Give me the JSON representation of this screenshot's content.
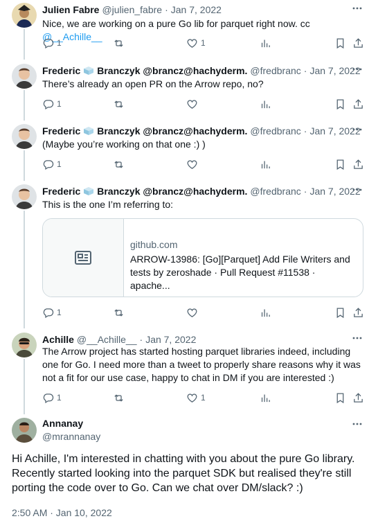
{
  "tweets": [
    {
      "name": "Julien Fabre",
      "handle": "@julien_fabre",
      "date": "Jan 7, 2022",
      "text_prefix": "Nice, we are working on a pure Go lib for parquet right now. cc ",
      "mention": "@__Achille__",
      "replies": "1",
      "retweets": "",
      "likes": "1"
    },
    {
      "name": "Frederic",
      "name_suffix": "Branczyk @brancz@hachyderm.",
      "handle": "@fredbranc",
      "date": "Jan 7, 2022",
      "text": "There’s already an open PR on the Arrow repo, no?",
      "replies": "1",
      "retweets": "",
      "likes": ""
    },
    {
      "name": "Frederic",
      "name_suffix": "Branczyk @brancz@hachyderm.",
      "handle": "@fredbranc",
      "date": "Jan 7, 2022",
      "text": "(Maybe you’re working on that one :) )",
      "replies": "1",
      "retweets": "",
      "likes": ""
    },
    {
      "name": "Frederic",
      "name_suffix": "Branczyk @brancz@hachyderm.",
      "handle": "@fredbranc",
      "date": "Jan 7, 2022",
      "text": "This is the one I’m referring to:",
      "card": {
        "domain": "github.com",
        "title": "ARROW-13986: [Go][Parquet] Add File Writers and tests by zeroshade · Pull Request #11538 · apache..."
      },
      "replies": "1",
      "retweets": "",
      "likes": ""
    },
    {
      "name": "Achille",
      "handle": "@__Achille__",
      "date": "Jan 7, 2022",
      "text": "The Arrow project has started hosting parquet libraries indeed, including one for Go. I need more than a tweet to properly share reasons why it was not a fit for our use case, happy to chat in DM if you are interested :)",
      "replies": "1",
      "retweets": "",
      "likes": "1"
    }
  ],
  "main_tweet": {
    "name": "Annanay",
    "handle": "@mrannanay",
    "text": "Hi Achille, I'm interested in chatting with you about the pure Go library. Recently started looking into the parquet SDK but realised they're still porting the code over to Go. Can we chat over DM/slack? :)",
    "timestamp": "2:50 AM · Jan 10, 2022"
  },
  "colors": {
    "text": "#0f1419",
    "secondary": "#536471",
    "link": "#1d9bf0",
    "border": "#cfd9de"
  }
}
